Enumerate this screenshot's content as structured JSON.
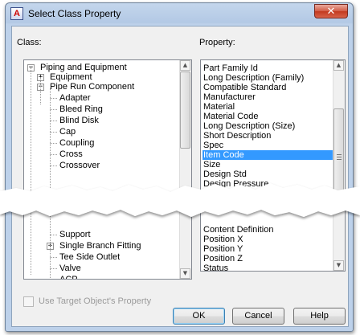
{
  "window": {
    "title": "Select Class Property",
    "app_icon_glyph": "A",
    "close_glyph": "✕"
  },
  "class_panel": {
    "label": "Class:",
    "tree": [
      {
        "text": "Piping and Equipment",
        "level": 0,
        "expander": "−"
      },
      {
        "text": "Equipment",
        "level": 1,
        "expander": "+"
      },
      {
        "text": "Pipe Run Component",
        "level": 1,
        "expander": "−"
      },
      {
        "text": "Adapter",
        "level": 2
      },
      {
        "text": "Bleed Ring",
        "level": 2
      },
      {
        "text": "Blind Disk",
        "level": 2
      },
      {
        "text": "Cap",
        "level": 2
      },
      {
        "text": "Coupling",
        "level": 2
      },
      {
        "text": "Cross",
        "level": 2
      },
      {
        "text": "Crossover",
        "level": 2
      },
      {
        "text": "Support",
        "level": 2
      },
      {
        "text": "Single Branch Fitting",
        "level": 2,
        "expander": "+"
      },
      {
        "text": "Tee Side Outlet",
        "level": 2
      },
      {
        "text": "Valve",
        "level": 2
      },
      {
        "text": "ACP",
        "level": 2
      }
    ]
  },
  "property_panel": {
    "label": "Property:",
    "items": [
      "Part Family Id",
      "Long Description (Family)",
      "Compatible Standard",
      "Manufacturer",
      "Material",
      "Material Code",
      "Long Description (Size)",
      "Short Description",
      "Spec",
      "Item Code",
      "Size",
      "Design Std",
      "Design Pressure",
      "Content Definition",
      "Position X",
      "Position Y",
      "Position Z",
      "Status"
    ],
    "selected_item": "Item Code"
  },
  "checkbox": {
    "label": "Use Target Object's Property",
    "checked": false,
    "enabled": false
  },
  "buttons": {
    "ok": "OK",
    "cancel": "Cancel",
    "help": "Help"
  },
  "colors": {
    "selection": "#3399ff",
    "dialog_bg": "#f0f0f0",
    "frame": "#c4d6ec",
    "close_button": "#c2391f"
  }
}
